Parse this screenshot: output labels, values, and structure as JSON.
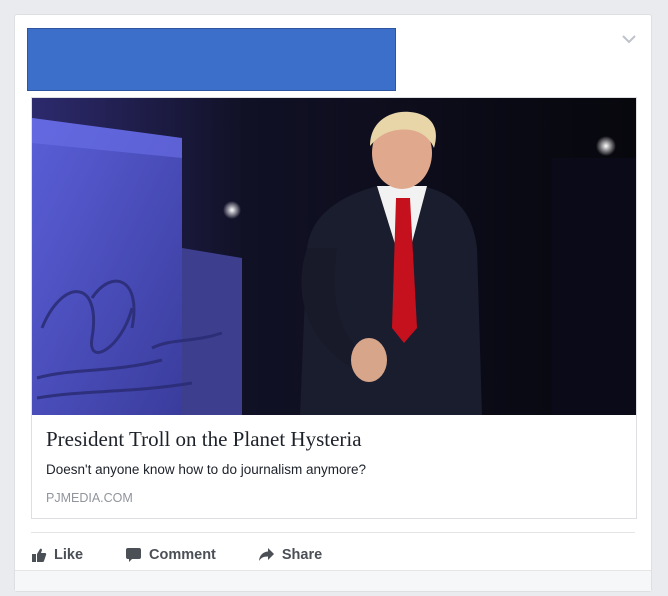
{
  "post": {
    "link": {
      "title": "President Troll on the Planet Hysteria",
      "description": "Doesn't anyone know how to do journalism anymore?",
      "domain": "PJMEDIA.COM"
    },
    "actions": {
      "like_label": "Like",
      "comment_label": "Comment",
      "share_label": "Share"
    }
  },
  "colors": {
    "redaction": "#3b6fc9",
    "action_text": "#4b4f56",
    "domain_text": "#90949c"
  }
}
